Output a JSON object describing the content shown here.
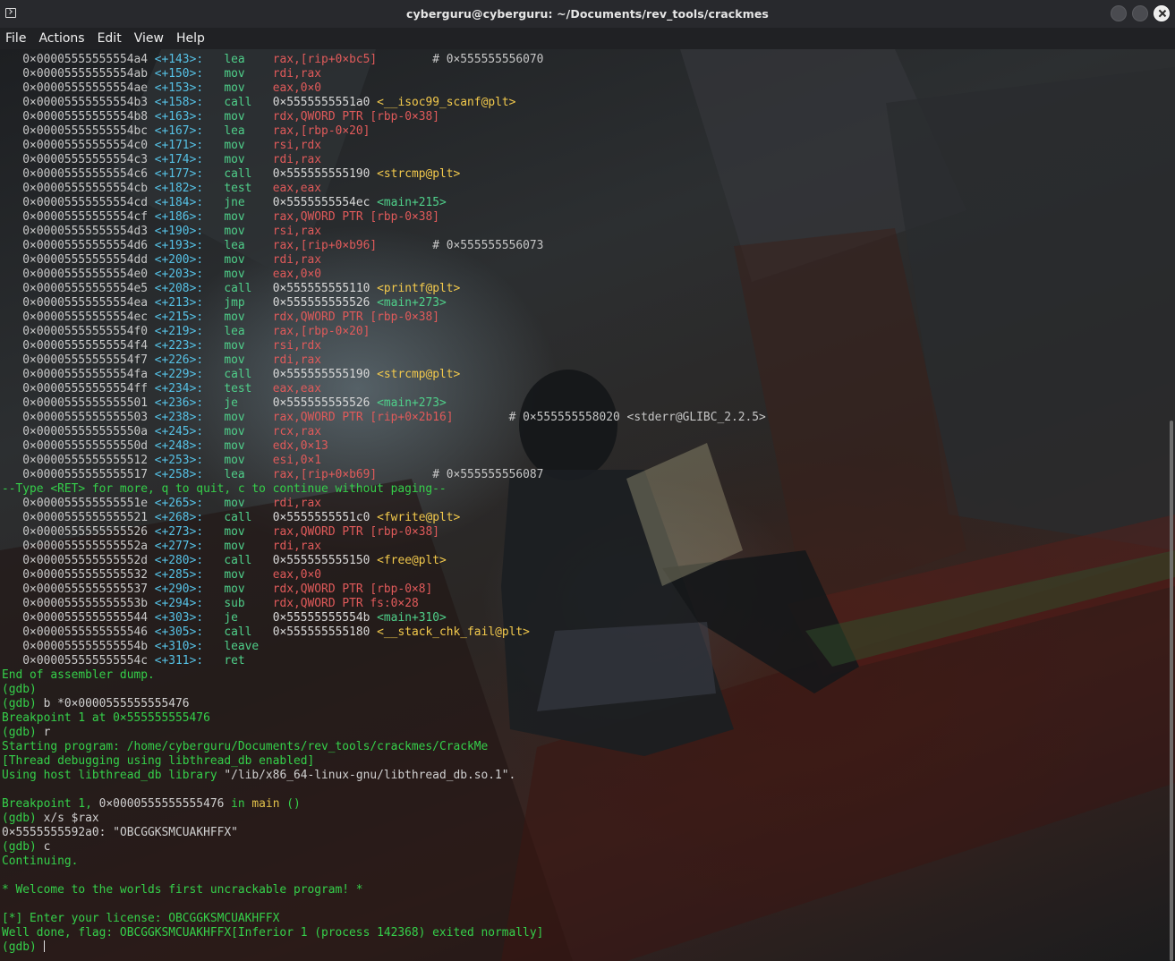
{
  "window": {
    "title": "cyberguru@cyberguru: ~/Documents/rev_tools/crackmes",
    "terminal_icon": "terminal-icon",
    "buttons": [
      "minimize-icon",
      "maximize-icon",
      "close-icon"
    ]
  },
  "menu": [
    "File",
    "Actions",
    "Edit",
    "View",
    "Help"
  ],
  "disasm": [
    {
      "addr": "0×00005555555554a4",
      "off": "<+143>:",
      "mn": "lea",
      "op": "rax,[rip+0×bc5]",
      "cm": "# 0×555555556070"
    },
    {
      "addr": "0×00005555555554ab",
      "off": "<+150>:",
      "mn": "mov",
      "op": "rdi,rax",
      "cm": ""
    },
    {
      "addr": "0×00005555555554ae",
      "off": "<+153>:",
      "mn": "mov",
      "op": "eax,0×0",
      "cm": ""
    },
    {
      "addr": "0×00005555555554b3",
      "off": "<+158>:",
      "mn": "call",
      "op": "0×5555555551a0 <__isoc99_scanf@plt>",
      "cm": ""
    },
    {
      "addr": "0×00005555555554b8",
      "off": "<+163>:",
      "mn": "mov",
      "op": "rdx,QWORD PTR [rbp-0×38]",
      "cm": ""
    },
    {
      "addr": "0×00005555555554bc",
      "off": "<+167>:",
      "mn": "lea",
      "op": "rax,[rbp-0×20]",
      "cm": ""
    },
    {
      "addr": "0×00005555555554c0",
      "off": "<+171>:",
      "mn": "mov",
      "op": "rsi,rdx",
      "cm": ""
    },
    {
      "addr": "0×00005555555554c3",
      "off": "<+174>:",
      "mn": "mov",
      "op": "rdi,rax",
      "cm": ""
    },
    {
      "addr": "0×00005555555554c6",
      "off": "<+177>:",
      "mn": "call",
      "op": "0×555555555190 <strcmp@plt>",
      "cm": ""
    },
    {
      "addr": "0×00005555555554cb",
      "off": "<+182>:",
      "mn": "test",
      "op": "eax,eax",
      "cm": ""
    },
    {
      "addr": "0×00005555555554cd",
      "off": "<+184>:",
      "mn": "jne",
      "op": "0×5555555554ec <main+215>",
      "cm": ""
    },
    {
      "addr": "0×00005555555554cf",
      "off": "<+186>:",
      "mn": "mov",
      "op": "rax,QWORD PTR [rbp-0×38]",
      "cm": ""
    },
    {
      "addr": "0×00005555555554d3",
      "off": "<+190>:",
      "mn": "mov",
      "op": "rsi,rax",
      "cm": ""
    },
    {
      "addr": "0×00005555555554d6",
      "off": "<+193>:",
      "mn": "lea",
      "op": "rax,[rip+0×b96]",
      "cm": "# 0×555555556073"
    },
    {
      "addr": "0×00005555555554dd",
      "off": "<+200>:",
      "mn": "mov",
      "op": "rdi,rax",
      "cm": ""
    },
    {
      "addr": "0×00005555555554e0",
      "off": "<+203>:",
      "mn": "mov",
      "op": "eax,0×0",
      "cm": ""
    },
    {
      "addr": "0×00005555555554e5",
      "off": "<+208>:",
      "mn": "call",
      "op": "0×555555555110 <printf@plt>",
      "cm": ""
    },
    {
      "addr": "0×00005555555554ea",
      "off": "<+213>:",
      "mn": "jmp",
      "op": "0×555555555526 <main+273>",
      "cm": ""
    },
    {
      "addr": "0×00005555555554ec",
      "off": "<+215>:",
      "mn": "mov",
      "op": "rdx,QWORD PTR [rbp-0×38]",
      "cm": ""
    },
    {
      "addr": "0×00005555555554f0",
      "off": "<+219>:",
      "mn": "lea",
      "op": "rax,[rbp-0×20]",
      "cm": ""
    },
    {
      "addr": "0×00005555555554f4",
      "off": "<+223>:",
      "mn": "mov",
      "op": "rsi,rdx",
      "cm": ""
    },
    {
      "addr": "0×00005555555554f7",
      "off": "<+226>:",
      "mn": "mov",
      "op": "rdi,rax",
      "cm": ""
    },
    {
      "addr": "0×00005555555554fa",
      "off": "<+229>:",
      "mn": "call",
      "op": "0×555555555190 <strcmp@plt>",
      "cm": ""
    },
    {
      "addr": "0×00005555555554ff",
      "off": "<+234>:",
      "mn": "test",
      "op": "eax,eax",
      "cm": ""
    },
    {
      "addr": "0×0000555555555501",
      "off": "<+236>:",
      "mn": "je",
      "op": "0×555555555526 <main+273>",
      "cm": ""
    },
    {
      "addr": "0×0000555555555503",
      "off": "<+238>:",
      "mn": "mov",
      "op": "rax,QWORD PTR [rip+0×2b16]",
      "cm": "# 0×555555558020 <stderr@GLIBC_2.2.5>"
    },
    {
      "addr": "0×000055555555550a",
      "off": "<+245>:",
      "mn": "mov",
      "op": "rcx,rax",
      "cm": ""
    },
    {
      "addr": "0×000055555555550d",
      "off": "<+248>:",
      "mn": "mov",
      "op": "edx,0×13",
      "cm": ""
    },
    {
      "addr": "0×0000555555555512",
      "off": "<+253>:",
      "mn": "mov",
      "op": "esi,0×1",
      "cm": ""
    },
    {
      "addr": "0×0000555555555517",
      "off": "<+258>:",
      "mn": "lea",
      "op": "rax,[rip+0×b69]",
      "cm": "# 0×555555556087"
    }
  ],
  "pager_prompt": "--Type <RET> for more, q to quit, c to continue without paging--",
  "disasm2": [
    {
      "addr": "0×000055555555551e",
      "off": "<+265>:",
      "mn": "mov",
      "op": "rdi,rax",
      "cm": ""
    },
    {
      "addr": "0×0000555555555521",
      "off": "<+268>:",
      "mn": "call",
      "op": "0×5555555551c0 <fwrite@plt>",
      "cm": ""
    },
    {
      "addr": "0×0000555555555526",
      "off": "<+273>:",
      "mn": "mov",
      "op": "rax,QWORD PTR [rbp-0×38]",
      "cm": ""
    },
    {
      "addr": "0×000055555555552a",
      "off": "<+277>:",
      "mn": "mov",
      "op": "rdi,rax",
      "cm": ""
    },
    {
      "addr": "0×000055555555552d",
      "off": "<+280>:",
      "mn": "call",
      "op": "0×555555555150 <free@plt>",
      "cm": ""
    },
    {
      "addr": "0×0000555555555532",
      "off": "<+285>:",
      "mn": "mov",
      "op": "eax,0×0",
      "cm": ""
    },
    {
      "addr": "0×0000555555555537",
      "off": "<+290>:",
      "mn": "mov",
      "op": "rdx,QWORD PTR [rbp-0×8]",
      "cm": ""
    },
    {
      "addr": "0×000055555555553b",
      "off": "<+294>:",
      "mn": "sub",
      "op": "rdx,QWORD PTR fs:0×28",
      "cm": ""
    },
    {
      "addr": "0×0000555555555544",
      "off": "<+303>:",
      "mn": "je",
      "op": "0×55555555554b <main+310>",
      "cm": ""
    },
    {
      "addr": "0×0000555555555546",
      "off": "<+305>:",
      "mn": "call",
      "op": "0×555555555180 <__stack_chk_fail@plt>",
      "cm": ""
    },
    {
      "addr": "0×000055555555554b",
      "off": "<+310>:",
      "mn": "leave",
      "op": "",
      "cm": ""
    },
    {
      "addr": "0×000055555555554c",
      "off": "<+311>:",
      "mn": "ret",
      "op": "",
      "cm": ""
    }
  ],
  "session": {
    "end_dump": "End of assembler dump.",
    "prompt": "(gdb)",
    "cmd_break": "b *0×0000555555555476",
    "bp_set": "Breakpoint 1 at 0×555555555476",
    "cmd_run": "r",
    "starting_label": "Starting program: ",
    "program_path": "/home/cyberguru/Documents/rev_tools/crackmes/CrackMe",
    "thread_debug": "[Thread debugging using libthread_db enabled]",
    "host_lib_label": "Using host libthread_db library ",
    "host_lib_path": "\"/lib/x86_64-linux-gnu/libthread_db.so.1\".",
    "bp_hit_a": "Breakpoint 1, ",
    "bp_hit_addr": "0×0000555555555476",
    "bp_hit_in": " in ",
    "bp_hit_fn": "main",
    "bp_hit_args": " ()",
    "cmd_xs": "x/s $rax",
    "xs_addr": "0×5555555592a0:",
    "xs_val": "\"OBCGGKSMCUAKHFFX\"",
    "cmd_c": "c",
    "continuing": "Continuing.",
    "welcome": "* Welcome to the worlds first uncrackable program! *",
    "license_prompt": "[*] Enter your license: OBCGGKSMCUAKHFFX",
    "flag_line": "Well done, flag: OBCGGKSMCUAKHFFX[Inferior 1 (process 142368) exited normally]"
  }
}
